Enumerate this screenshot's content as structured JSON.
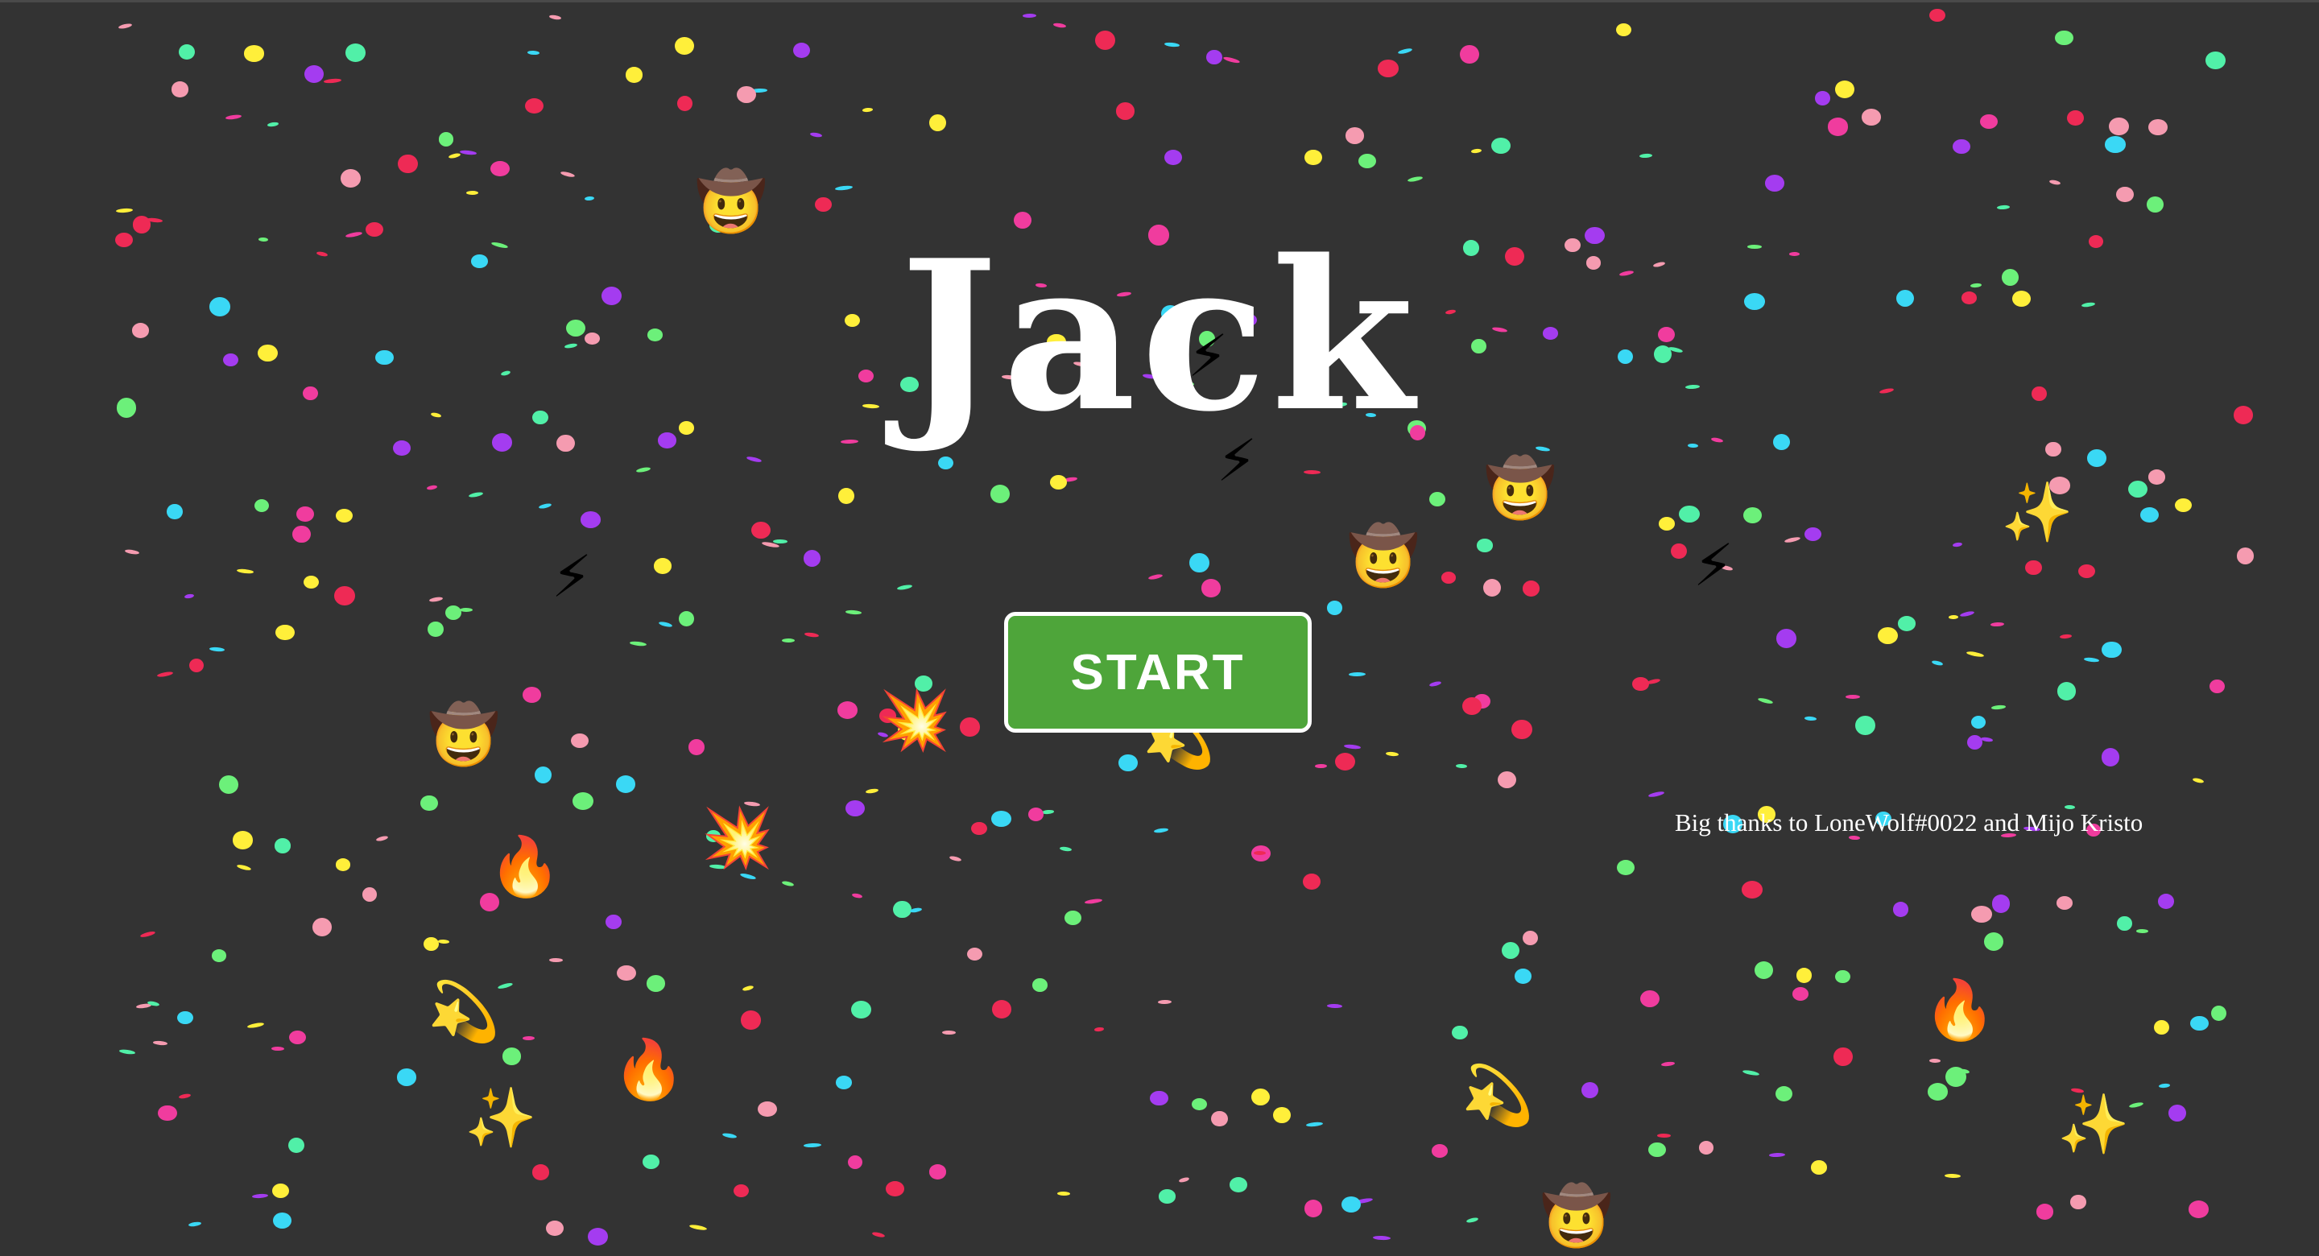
{
  "game": {
    "title": "Jack",
    "start_label": "START",
    "credits": "Big thanks to LoneWolf#0022 and Mijo Kristo"
  },
  "colors": {
    "background": "#333333",
    "button": "#4ea53a",
    "confetti": [
      "#f03c9e",
      "#ffef3a",
      "#6cf07a",
      "#a43cf0",
      "#3ad8f5",
      "#f59bb0",
      "#ee2a55",
      "#51f0a8"
    ]
  },
  "decorations": {
    "emoji_icons": [
      "cowboy-emoji",
      "lightning-emoji",
      "sparkles-emoji",
      "fire-emoji",
      "explosion-emoji",
      "dizzy-star-emoji"
    ]
  }
}
